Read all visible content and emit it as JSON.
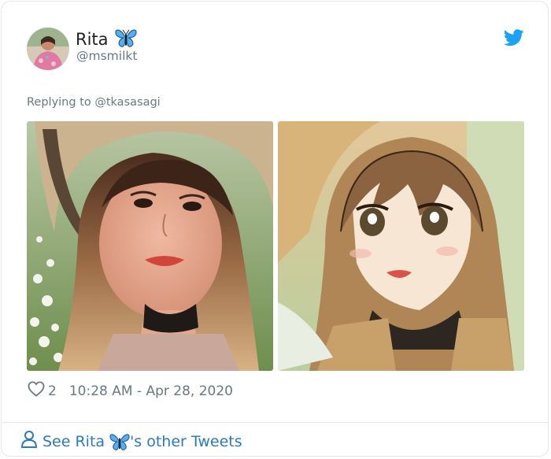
{
  "tweet": {
    "display_name": "Rita",
    "handle": "@msmilkt",
    "reply_prefix": "Replying to",
    "reply_to": "@tkasasagi",
    "like_count": "2",
    "timestamp": "10:28 AM - Apr 28, 2020"
  },
  "footer": {
    "see_prefix": "See Rita",
    "see_suffix": "'s other Tweets"
  },
  "icons": {
    "name_badge": "butterfly-icon",
    "logo": "twitter-bird-icon",
    "like": "heart-outline-icon",
    "footer": "person-icon"
  },
  "colors": {
    "link": "#2b7bb9",
    "secondary_text": "#697882",
    "twitter_blue": "#1da1f2",
    "butterfly_blue": "#3b88c3"
  }
}
